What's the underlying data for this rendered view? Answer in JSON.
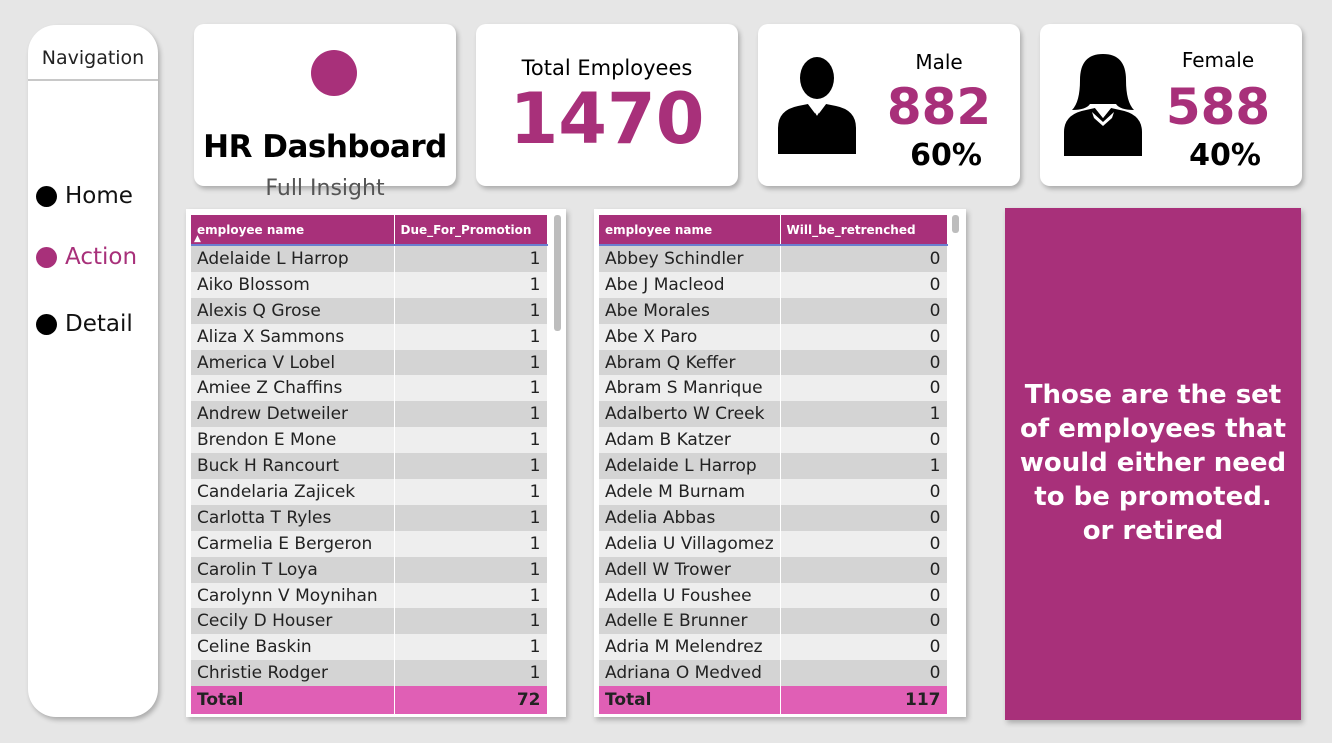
{
  "navigation": {
    "title": "Navigation",
    "items": [
      {
        "label": "Home"
      },
      {
        "label": "Action"
      },
      {
        "label": "Detail"
      }
    ]
  },
  "header": {
    "title": "HR Dashboard",
    "subtitle": "Full Insight"
  },
  "kpis": {
    "total_label": "Total Employees",
    "total_value": "1470",
    "male_label": "Male",
    "male_value": "882",
    "male_pct": "60%",
    "female_label": "Female",
    "female_value": "588",
    "female_pct": "40%"
  },
  "colors": {
    "accent": "#a8307a",
    "total_row": "#e05fb5"
  },
  "promotion_table": {
    "columns": [
      "employee name",
      "Due_For_Promotion"
    ],
    "rows": [
      [
        "Adelaide L Harrop",
        "1"
      ],
      [
        "Aiko Blossom",
        "1"
      ],
      [
        "Alexis Q Grose",
        "1"
      ],
      [
        "Aliza X Sammons",
        "1"
      ],
      [
        "America V Lobel",
        "1"
      ],
      [
        "Amiee Z Chaffins",
        "1"
      ],
      [
        "Andrew Detweiler",
        "1"
      ],
      [
        "Brendon E Mone",
        "1"
      ],
      [
        "Buck H Rancourt",
        "1"
      ],
      [
        "Candelaria Zajicek",
        "1"
      ],
      [
        "Carlotta T Ryles",
        "1"
      ],
      [
        "Carmelia E Bergeron",
        "1"
      ],
      [
        "Carolin T Loya",
        "1"
      ],
      [
        "Carolynn V Moynihan",
        "1"
      ],
      [
        "Cecily D Houser",
        "1"
      ],
      [
        "Celine Baskin",
        "1"
      ],
      [
        "Christie Rodger",
        "1"
      ]
    ],
    "total_label": "Total",
    "total_value": "72"
  },
  "retrench_table": {
    "columns": [
      "employee name",
      "Will_be_retrenched"
    ],
    "rows": [
      [
        "Abbey Schindler",
        "0"
      ],
      [
        "Abe J Macleod",
        "0"
      ],
      [
        "Abe Morales",
        "0"
      ],
      [
        "Abe X Paro",
        "0"
      ],
      [
        "Abram Q Keffer",
        "0"
      ],
      [
        "Abram S Manrique",
        "0"
      ],
      [
        "Adalberto W Creek",
        "1"
      ],
      [
        "Adam B Katzer",
        "0"
      ],
      [
        "Adelaide L Harrop",
        "1"
      ],
      [
        "Adele M Burnam",
        "0"
      ],
      [
        "Adelia Abbas",
        "0"
      ],
      [
        "Adelia U Villagomez",
        "0"
      ],
      [
        "Adell W Trower",
        "0"
      ],
      [
        "Adella U Foushee",
        "0"
      ],
      [
        "Adelle E Brunner",
        "0"
      ],
      [
        "Adria M Melendrez",
        "0"
      ],
      [
        "Adriana O Medved",
        "0"
      ]
    ],
    "total_label": "Total",
    "total_value": "117"
  },
  "note": {
    "lines": [
      "Those are the set",
      "of employees that",
      "would either need",
      "to be promoted.",
      "or retired"
    ]
  }
}
